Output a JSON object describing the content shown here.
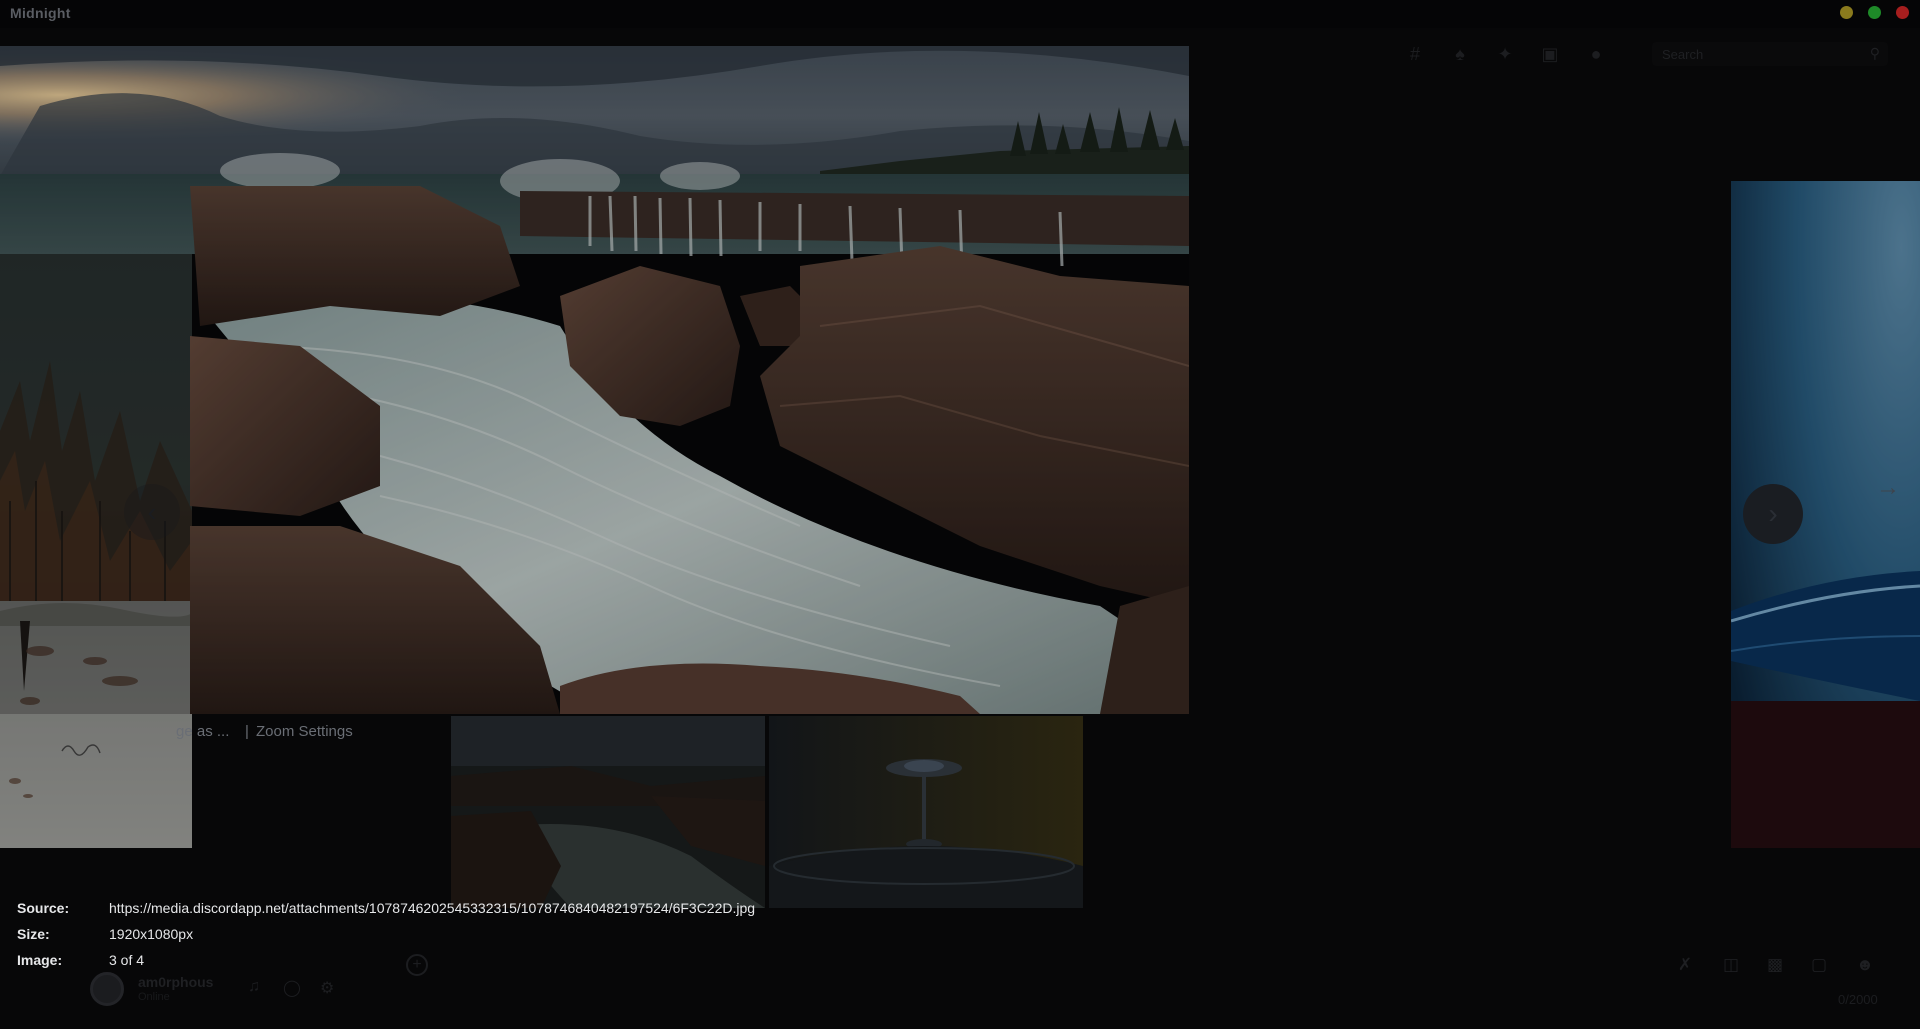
{
  "window": {
    "title": "Midnight",
    "colors": {
      "minimize": "#8a7a1d",
      "maximize": "#1e8a28",
      "close": "#a61e1e"
    }
  },
  "background_app": {
    "search_placeholder": "Search",
    "toolbar_icons": [
      "threads-icon",
      "bell-icon",
      "pin-icon",
      "inbox-icon",
      "members-icon"
    ],
    "user": {
      "name": "am0rphous",
      "status": "Online"
    },
    "composer_icons": [
      "gift-off-icon",
      "gift-icon",
      "gif-icon",
      "sticker-icon",
      "emoji-icon"
    ],
    "char_count": "0/2000"
  },
  "viewer": {
    "controls": {
      "save": "ge as ...",
      "separator": "|",
      "zoom": "Zoom Settings"
    },
    "thumbnails": [
      "waterfall-rocks-thumbnail",
      "water-drop-thumbnail"
    ],
    "info": {
      "source_label": "Source:",
      "source_value": "https://media.discordapp.net/attachments/1078746202545332315/1078746840482197524/6F3C22D.jpg",
      "size_label": "Size:",
      "size_value": "1920x1080px",
      "image_label": "Image:",
      "image_value": "3 of 4"
    }
  }
}
